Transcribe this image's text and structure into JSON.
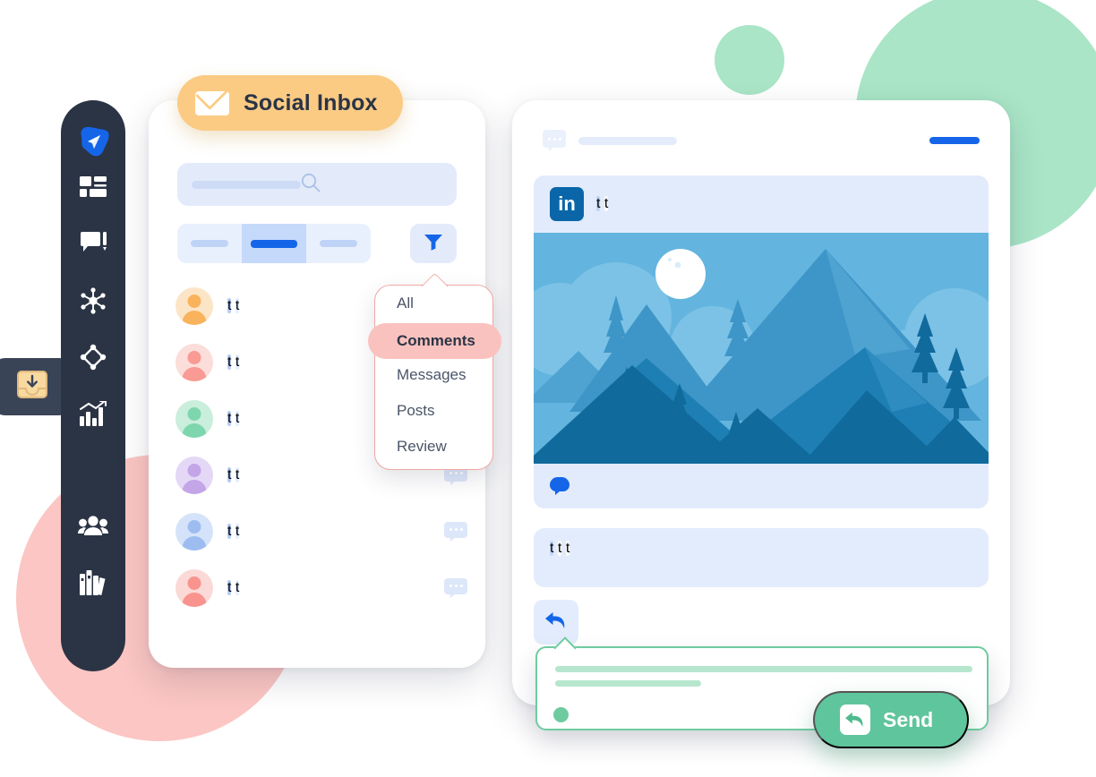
{
  "palette": {
    "sidebar_bg": "#2B3445",
    "sidebar_active_bg": "#3A4457",
    "accent_blue": "#1565E8",
    "badge_amber": "#FBCB84",
    "dropdown_pink": "#FAC2BF",
    "dropdown_border": "#F0A7A4",
    "send_green": "#5FC59C",
    "composer_green": "#6ECBA0",
    "blob_green": "#A9E5C6",
    "blob_pink": "#FBC6C3",
    "linkedin_blue": "#0A66A8",
    "placeholder_blue": "#E3EBFB"
  },
  "background": {
    "blobs": [
      {
        "name": "blob-green-large",
        "color": "#A9E5C6"
      },
      {
        "name": "blob-green-small",
        "color": "#A9E5C6"
      },
      {
        "name": "blob-pink-large",
        "color": "#FBC6C3"
      }
    ]
  },
  "sidebar": {
    "logo": {
      "icon": "paper-plane-icon",
      "color": "#1565E8"
    },
    "items": [
      {
        "icon": "dashboard-grid-icon",
        "active": false
      },
      {
        "icon": "comment-edit-icon",
        "active": false
      },
      {
        "icon": "network-nodes-icon",
        "active": false
      },
      {
        "icon": "diamond-nodes-icon",
        "active": false
      },
      {
        "icon": "analytics-chart-icon",
        "active": false
      },
      {
        "icon": "inbox-download-icon",
        "active": true
      },
      {
        "icon": "team-people-icon",
        "active": false
      },
      {
        "icon": "library-books-icon",
        "active": false
      }
    ]
  },
  "badge": {
    "label": "Social Inbox",
    "icon": "envelope-icon"
  },
  "inbox_panel": {
    "search": {
      "icon": "search-icon",
      "placeholder": ""
    },
    "tabs": [
      {
        "name": "tab-one",
        "active": false
      },
      {
        "name": "tab-two",
        "active": true
      },
      {
        "name": "tab-three",
        "active": false
      }
    ],
    "filter_button": {
      "icon": "funnel-icon"
    },
    "messages": [
      {
        "avatar_color": "#F9B35C",
        "avatar_bg": "#FCE5C6",
        "has_bubble": false
      },
      {
        "avatar_color": "#F99A94",
        "avatar_bg": "#FBDDDA",
        "has_bubble": false
      },
      {
        "avatar_color": "#7ED6AE",
        "avatar_bg": "#C9EEDC",
        "has_bubble": false
      },
      {
        "avatar_color": "#C3A5E8",
        "avatar_bg": "#E4D8F6",
        "has_bubble": true
      },
      {
        "avatar_color": "#9DBDF0",
        "avatar_bg": "#D5E3FA",
        "has_bubble": true
      },
      {
        "avatar_color": "#F8938D",
        "avatar_bg": "#FBD9D6",
        "has_bubble": true
      }
    ]
  },
  "dropdown": {
    "items": [
      {
        "label": "All",
        "selected": false
      },
      {
        "label": "Comments",
        "selected": true
      },
      {
        "label": "Messages",
        "selected": false
      },
      {
        "label": "Posts",
        "selected": false
      },
      {
        "label": "Review",
        "selected": false
      }
    ]
  },
  "post_panel": {
    "header": {
      "icon": "comment-bubble-icon"
    },
    "author": {
      "network_icon": "linkedin-icon",
      "network_label": "in"
    },
    "image": {
      "name": "mountain-landscape-illustration",
      "sky": "#63B5DF",
      "moon": "#FFFFFF",
      "mountain_far": "#5BA8D4",
      "mountain_mid": "#3E96C8",
      "mountain_near": "#1E7FB5",
      "mountain_front": "#116A9C"
    },
    "reactions": {
      "icon": "comment-bubble-filled-icon"
    },
    "reply_button": {
      "icon": "reply-arrow-icon"
    }
  },
  "composer": {
    "status_dot_color": "#6ECBA0"
  },
  "send_button": {
    "label": "Send",
    "icon": "reply-arrow-icon"
  }
}
